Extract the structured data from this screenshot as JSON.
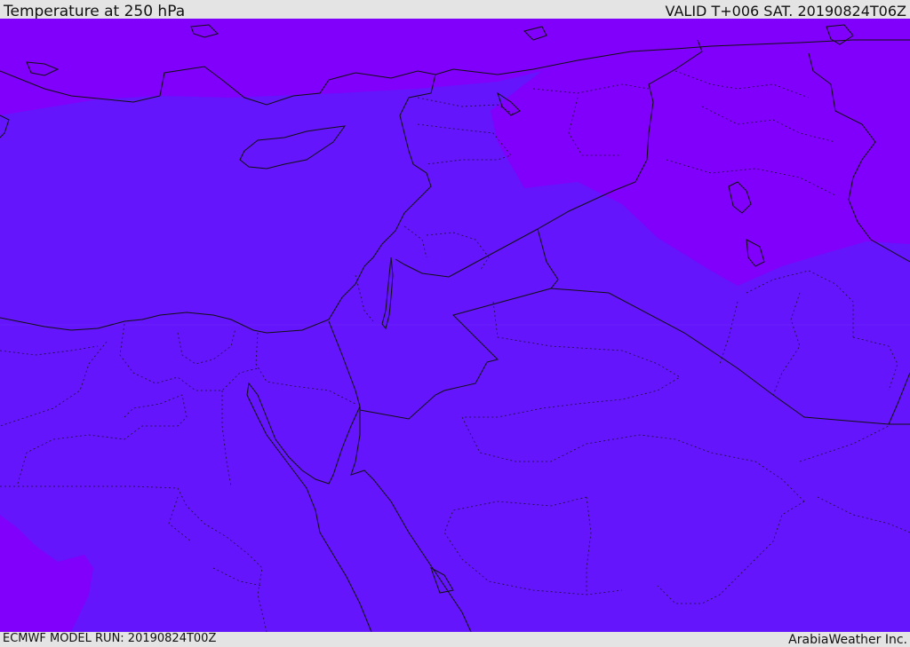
{
  "header": {
    "title": "Temperature at 250 hPa",
    "valid_time": "VALID T+006 SAT. 20190824T06Z"
  },
  "footer": {
    "model_run": "ECMWF MODEL RUN: 20190824T00Z",
    "credit": "ArabiaWeather Inc."
  },
  "map": {
    "field": "temperature",
    "level": "250 hPa",
    "colors": {
      "warm_band": "#6415fb",
      "cold_band": "#8000fb",
      "coastline": "#111111",
      "border": "#111111"
    }
  }
}
